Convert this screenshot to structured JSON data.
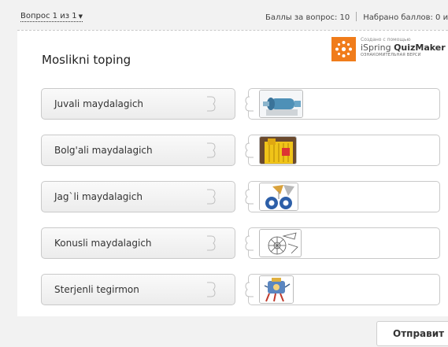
{
  "header": {
    "question_counter": "Вопрос 1 из 1",
    "points_per_question": "Баллы за вопрос: 10",
    "points_total": "Набрано баллов: 0 и"
  },
  "branding": {
    "created_with": "Создано с помощью",
    "product_prefix": "iSpring ",
    "product_name": "QuizMaker",
    "trial_note": "ОЗНАКОМИТЕЛЬНАЯ ВЕРСИ",
    "accent_color": "#f07c1b"
  },
  "question": {
    "title": "Moslikni toping",
    "items": [
      {
        "label": "Juvali maydalagich",
        "image_icon": "ball-mill-image"
      },
      {
        "label": "Bolg'ali maydalagich",
        "image_icon": "hammer-crusher-image"
      },
      {
        "label": "Jag`li maydalagich",
        "image_icon": "jaw-crusher-image"
      },
      {
        "label": "Konusli maydalagich",
        "image_icon": "cone-crusher-image"
      },
      {
        "label": "Sterjenli tegirmon",
        "image_icon": "rod-mill-image"
      }
    ]
  },
  "footer": {
    "submit_label": "Отправит"
  }
}
